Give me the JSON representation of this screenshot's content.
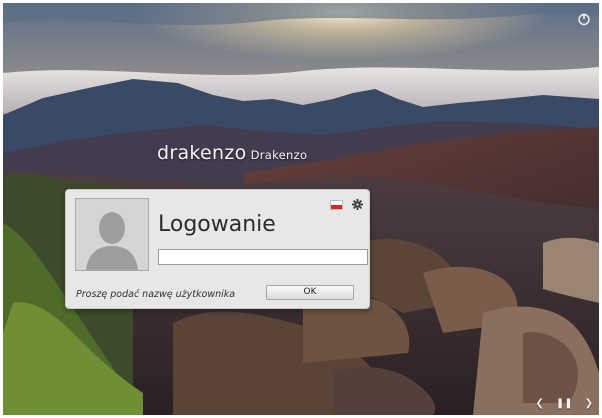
{
  "screen": {
    "hostname": "drakenzo",
    "hostname_sub": "Drakenzo",
    "power_icon": "power-icon",
    "nav_icons": [
      "chevron-left-icon",
      "pause-icon",
      "chevron-right-icon"
    ]
  },
  "login": {
    "title": "Logowanie",
    "username_value": "",
    "prompt": "Proszę podać nazwę użytkownika",
    "ok_label": "OK",
    "language_icon": "flag-pl-icon",
    "settings_icon": "gear-icon",
    "avatar_icon": "user-silhouette-icon"
  },
  "colors": {
    "dialog_bg": "#e7e7e7",
    "text_white": "#f4f4f4",
    "flag_red": "#d8232a"
  }
}
